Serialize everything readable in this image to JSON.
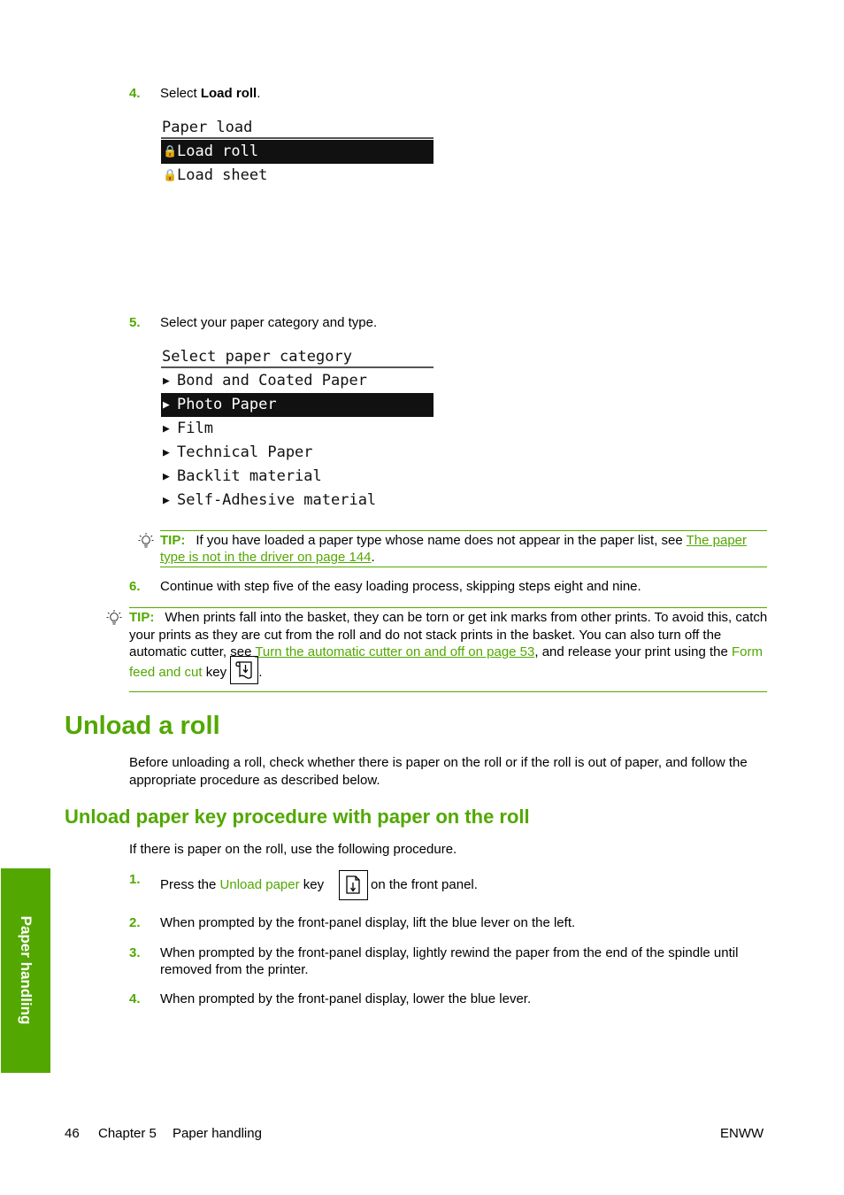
{
  "steps_top": [
    {
      "number": "4.",
      "text_before": "Select ",
      "text_bold": "Load roll",
      "text_after": "."
    },
    {
      "number": "5.",
      "text": "Select your paper category and type."
    },
    {
      "number": "6.",
      "text": "Continue with step five of the easy loading process, skipping steps eight and nine."
    }
  ],
  "panel_paper_load": {
    "title": "Paper load",
    "items": [
      {
        "icon": "lock-icon",
        "label": "Load roll",
        "selected": true
      },
      {
        "icon": "lock-icon",
        "label": "Load sheet",
        "selected": false
      }
    ]
  },
  "panel_paper_category": {
    "title": "Select paper category",
    "items": [
      {
        "icon": "arrow-right-icon",
        "label": "Bond and Coated Paper",
        "selected": false
      },
      {
        "icon": "arrow-right-icon",
        "label": "Photo Paper",
        "selected": true
      },
      {
        "icon": "arrow-right-icon",
        "label": "Film",
        "selected": false
      },
      {
        "icon": "arrow-right-icon",
        "label": "Technical Paper",
        "selected": false
      },
      {
        "icon": "arrow-right-icon",
        "label": "Backlit material",
        "selected": false
      },
      {
        "icon": "arrow-right-icon",
        "label": "Self-Adhesive material",
        "selected": false
      }
    ]
  },
  "tip1": {
    "label": "TIP:",
    "text": "If you have loaded a paper type whose name does not appear in the paper list, see ",
    "link": "The paper type is not in the driver on page 144",
    "after": "."
  },
  "tip2": {
    "label": "TIP:",
    "text": "When prints fall into the basket, they can be torn or get ink marks from other prints. To avoid this, catch your prints as they are cut from the roll and do not stack prints in the basket. You can also turn off the automatic cutter, see ",
    "link": "Turn the automatic cutter on and off on page 53",
    "mid": ", and release your print using the ",
    "key_name": "Form feed and cut",
    "key_word": " key",
    "after": "."
  },
  "section": {
    "title": "Unload a roll",
    "intro": "Before unloading a roll, check whether there is paper on the roll or if the roll is out of paper, and follow the appropriate procedure as described below.",
    "subtitle": "Unload paper key procedure with paper on the roll",
    "sub_intro": "If there is paper on the roll, use the following procedure.",
    "steps": [
      {
        "number": "1.",
        "before": "Press the ",
        "key_name": "Unload paper",
        "key_word": " key",
        "after": "on the front panel."
      },
      {
        "number": "2.",
        "text": "When prompted by the front-panel display, lift the blue lever on the left."
      },
      {
        "number": "3.",
        "text": "When prompted by the front-panel display, lightly rewind the paper from the end of the spindle until removed from the printer."
      },
      {
        "number": "4.",
        "text": "When prompted by the front-panel display, lower the blue lever."
      }
    ]
  },
  "side_tab": "Paper handling",
  "footer": {
    "page_number": "46",
    "chapter": "Chapter 5",
    "chapter_title": "Paper handling",
    "right": "ENWW"
  },
  "colors": {
    "accent": "#52a800"
  }
}
